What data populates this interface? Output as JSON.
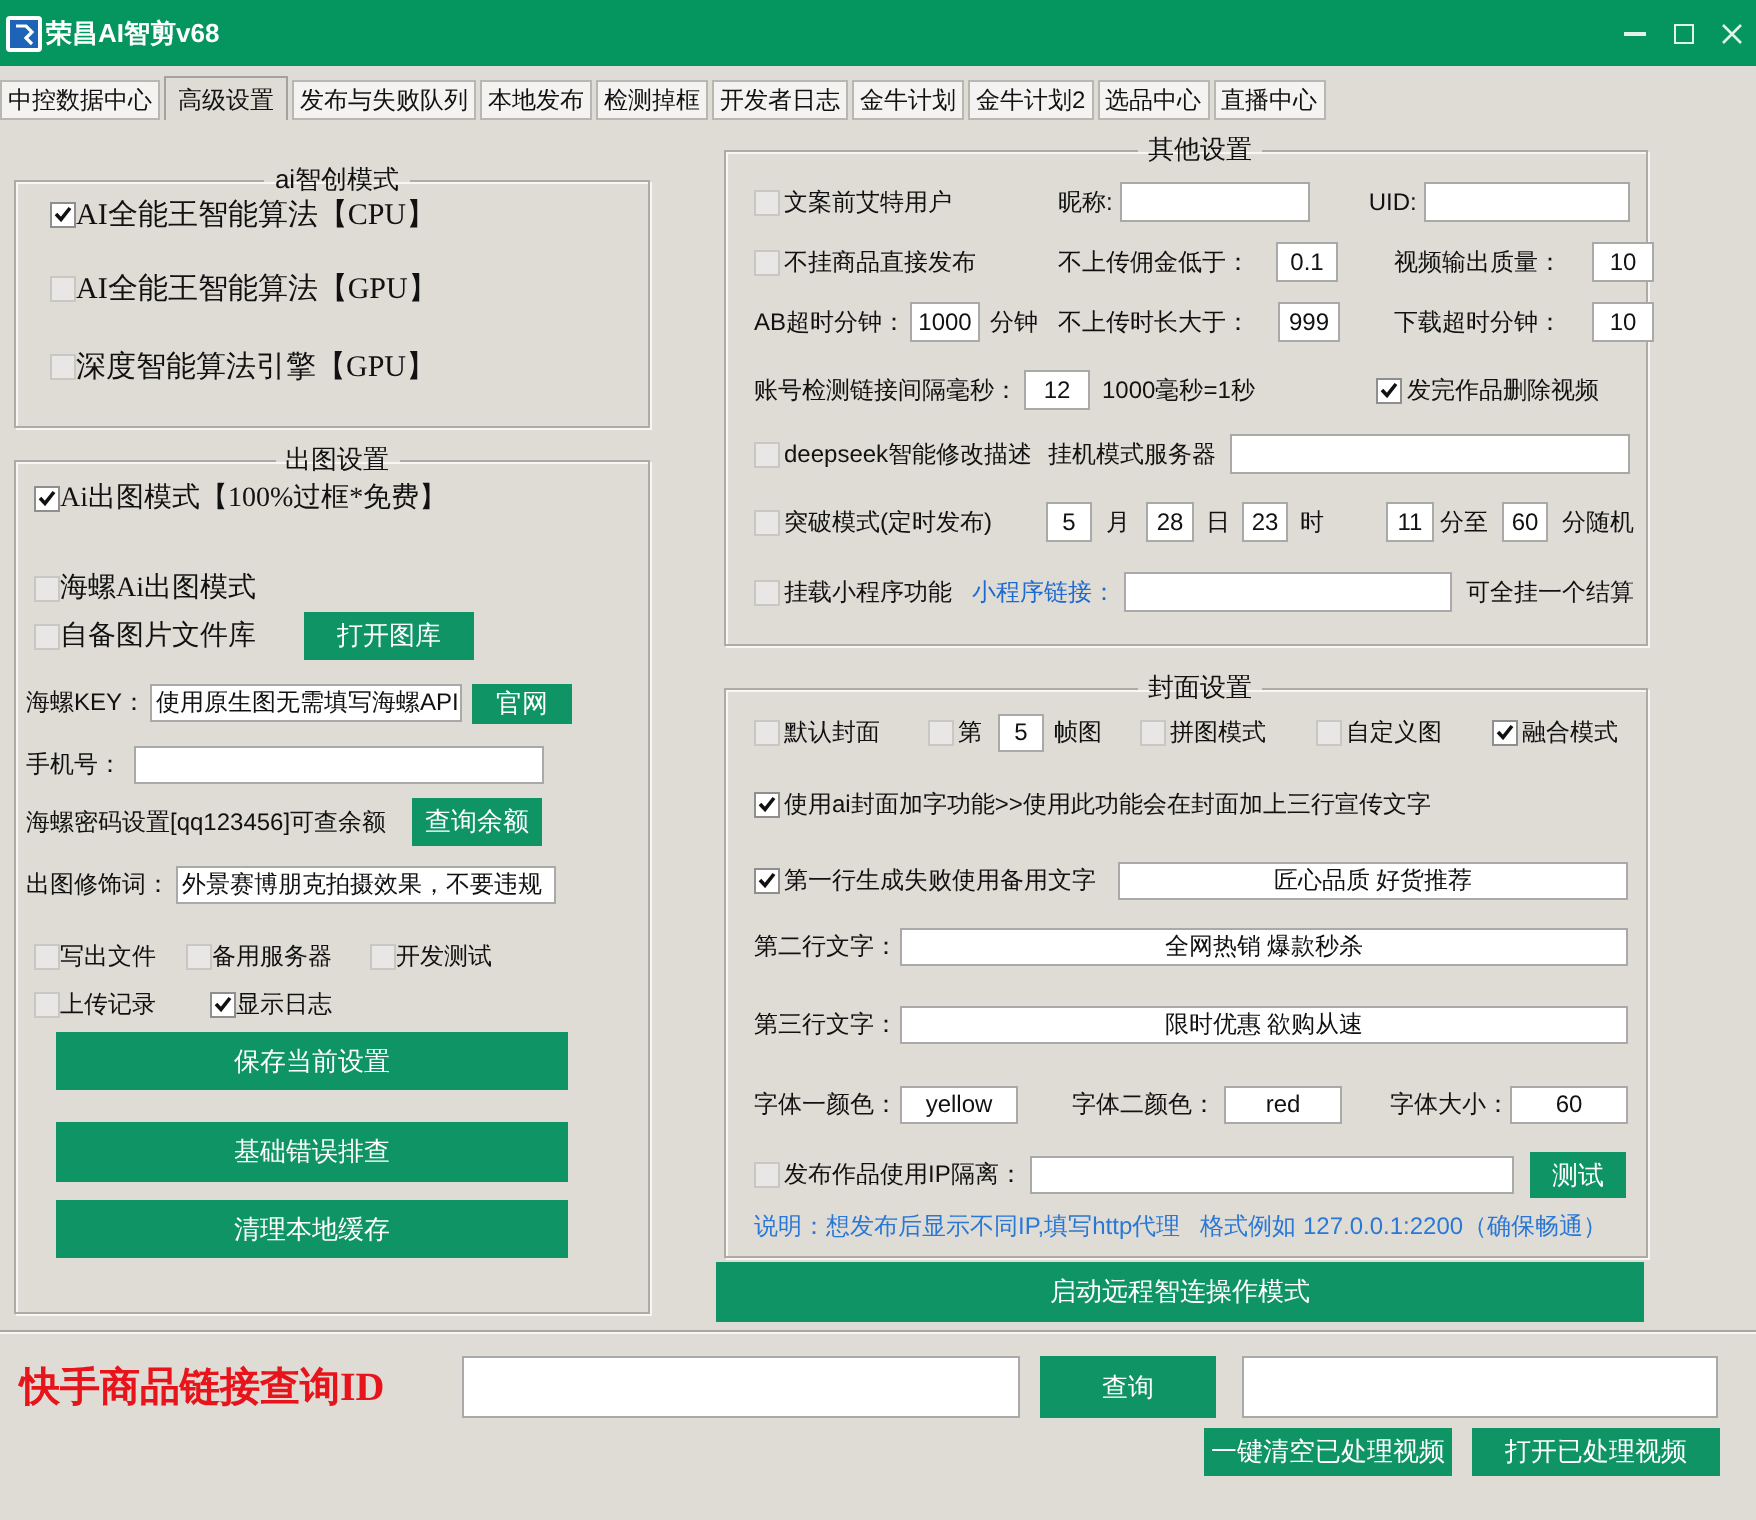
{
  "window": {
    "title": "荣昌AI智剪v68"
  },
  "tabs": [
    {
      "label": "中控数据中心",
      "selected": false
    },
    {
      "label": "高级设置",
      "selected": true
    },
    {
      "label": "发布与失败队列",
      "selected": false
    },
    {
      "label": "本地发布",
      "selected": false
    },
    {
      "label": "检测掉框",
      "selected": false
    },
    {
      "label": "开发者日志",
      "selected": false
    },
    {
      "label": "金牛计划",
      "selected": false
    },
    {
      "label": "金牛计划2",
      "selected": false
    },
    {
      "label": "选品中心",
      "selected": false
    },
    {
      "label": "直播中心",
      "selected": false
    }
  ],
  "ai_mode": {
    "title": "ai智创模式",
    "rows": [
      {
        "items": [
          {
            "kind": "checkbox",
            "label": "AI全能王智能算法【CPU】",
            "checked": true
          }
        ]
      },
      {
        "items": [
          {
            "kind": "checkbox",
            "label": "AI全能王智能算法【GPU】",
            "checked": false
          }
        ]
      },
      {
        "items": [
          {
            "kind": "checkbox",
            "label": "深度智能算法引擎【GPU】",
            "checked": false
          }
        ]
      }
    ]
  },
  "image_settings": {
    "title": "出图设置",
    "rows": [
      {
        "items": [
          {
            "kind": "checkbox",
            "label": "Ai出图模式【100%过框*免费】",
            "checked": true
          }
        ]
      },
      {
        "items": [
          {
            "kind": "checkbox",
            "label": "海螺Ai出图模式",
            "checked": false
          }
        ]
      },
      {
        "items": [
          {
            "kind": "checkbox",
            "label": "自备图片文件库",
            "checked": false
          },
          {
            "kind": "button",
            "label": "打开图库"
          }
        ]
      },
      {
        "items": [
          {
            "kind": "label",
            "text": "海螺KEY："
          },
          {
            "kind": "field",
            "value": "使用原生图无需填写海螺API"
          },
          {
            "kind": "button",
            "label": "官网"
          }
        ]
      },
      {
        "items": [
          {
            "kind": "label",
            "text": "手机号："
          },
          {
            "kind": "field"
          }
        ]
      },
      {
        "items": [
          {
            "kind": "label",
            "text": "海螺密码设置[qq123456]可查余额"
          },
          {
            "kind": "button",
            "label": "查询余额"
          }
        ]
      },
      {
        "items": [
          {
            "kind": "label",
            "text": "出图修饰词："
          },
          {
            "kind": "field",
            "value": "外景赛博朋克拍摄效果，不要违规"
          }
        ]
      },
      {
        "items": [
          {
            "kind": "checkbox",
            "label": "写出文件",
            "checked": false
          },
          {
            "kind": "checkbox",
            "label": "备用服务器",
            "checked": false
          },
          {
            "kind": "checkbox",
            "label": "开发测试",
            "checked": false
          }
        ]
      },
      {
        "items": [
          {
            "kind": "checkbox",
            "label": "上传记录",
            "checked": false
          },
          {
            "kind": "checkbox",
            "label": "显示日志",
            "checked": true
          }
        ]
      }
    ],
    "buttons": [
      "保存当前设置",
      "基础错误排查",
      "清理本地缓存"
    ]
  },
  "other_settings": {
    "title": "其他设置",
    "rows": [
      {
        "items": [
          {
            "kind": "checkbox",
            "label": "文案前艾特用户",
            "checked": false
          },
          {
            "kind": "label",
            "text": "昵称:"
          },
          {
            "kind": "field"
          },
          {
            "kind": "label",
            "text": "UID:"
          },
          {
            "kind": "field"
          }
        ]
      },
      {
        "items": [
          {
            "kind": "checkbox",
            "label": "不挂商品直接发布",
            "checked": false
          },
          {
            "kind": "label",
            "text": "不上传佣金低于："
          },
          {
            "kind": "field",
            "value": "0.1"
          },
          {
            "kind": "label",
            "text": "视频输出质量："
          },
          {
            "kind": "field",
            "value": "10"
          }
        ]
      },
      {
        "items": [
          {
            "kind": "label",
            "text": "AB超时分钟："
          },
          {
            "kind": "field",
            "value": "1000"
          },
          {
            "kind": "label",
            "text": "分钟"
          },
          {
            "kind": "label",
            "text": "不上传时长大于："
          },
          {
            "kind": "field",
            "value": "999"
          },
          {
            "kind": "label",
            "text": "下载超时分钟："
          },
          {
            "kind": "field",
            "value": "10"
          }
        ]
      },
      {
        "items": [
          {
            "kind": "label",
            "text": "账号检测链接间隔毫秒："
          },
          {
            "kind": "field",
            "value": "12"
          },
          {
            "kind": "label",
            "text": "1000毫秒=1秒"
          },
          {
            "kind": "checkbox",
            "label": "发完作品删除视频",
            "checked": true
          }
        ]
      },
      {
        "items": [
          {
            "kind": "checkbox",
            "label": "deepseek智能修改描述",
            "checked": false
          },
          {
            "kind": "label",
            "text": "挂机模式服务器"
          },
          {
            "kind": "field"
          }
        ]
      },
      {
        "items": [
          {
            "kind": "checkbox",
            "label": "突破模式(定时发布)",
            "checked": false
          },
          {
            "kind": "field",
            "value": "5"
          },
          {
            "kind": "label",
            "text": "月"
          },
          {
            "kind": "field",
            "value": "28"
          },
          {
            "kind": "label",
            "text": "日"
          },
          {
            "kind": "field",
            "value": "23"
          },
          {
            "kind": "label",
            "text": "时"
          },
          {
            "kind": "field",
            "value": "11"
          },
          {
            "kind": "label",
            "text": "分至"
          },
          {
            "kind": "field",
            "value": "60"
          },
          {
            "kind": "label",
            "text": "分随机"
          }
        ]
      },
      {
        "items": [
          {
            "kind": "checkbox",
            "label": "挂载小程序功能",
            "checked": false
          },
          {
            "kind": "link",
            "text": "小程序链接："
          },
          {
            "kind": "field"
          },
          {
            "kind": "label",
            "text": "可全挂一个结算"
          }
        ]
      }
    ]
  },
  "cover_settings": {
    "title": "封面设置",
    "rows": [
      {
        "items": [
          {
            "kind": "checkbox",
            "label": "默认封面",
            "checked": false
          },
          {
            "kind": "checkbox",
            "label": "第",
            "checked": false
          },
          {
            "kind": "field",
            "value": "5"
          },
          {
            "kind": "label",
            "text": "帧图"
          },
          {
            "kind": "checkbox",
            "label": "拼图模式",
            "checked": false
          },
          {
            "kind": "checkbox",
            "label": "自定义图",
            "checked": false
          },
          {
            "kind": "checkbox",
            "label": "融合模式",
            "checked": true
          }
        ]
      },
      {
        "items": [
          {
            "kind": "checkbox",
            "label": "使用ai封面加字功能>>使用此功能会在封面加上三行宣传文字",
            "checked": true
          }
        ]
      },
      {
        "items": [
          {
            "kind": "checkbox",
            "label": "第一行生成失败使用备用文字",
            "checked": true
          },
          {
            "kind": "field",
            "value": "匠心品质 好货推荐"
          }
        ]
      },
      {
        "items": [
          {
            "kind": "label",
            "text": "第二行文字："
          },
          {
            "kind": "field",
            "value": "全网热销 爆款秒杀"
          }
        ]
      },
      {
        "items": [
          {
            "kind": "label",
            "text": "第三行文字："
          },
          {
            "kind": "field",
            "value": "限时优惠 欲购从速"
          }
        ]
      },
      {
        "items": [
          {
            "kind": "label",
            "text": "字体一颜色："
          },
          {
            "kind": "field",
            "value": "yellow"
          },
          {
            "kind": "label",
            "text": "字体二颜色："
          },
          {
            "kind": "field",
            "value": "red"
          },
          {
            "kind": "label",
            "text": "字体大小："
          },
          {
            "kind": "field",
            "value": "60"
          }
        ]
      },
      {
        "items": [
          {
            "kind": "checkbox",
            "label": "发布作品使用IP隔离：",
            "checked": false
          },
          {
            "kind": "field"
          },
          {
            "kind": "button",
            "label": "测试"
          }
        ]
      },
      {
        "items": [
          {
            "kind": "note",
            "text": "说明：想发布后显示不同IP,填写http代理   格式例如 127.0.0.1:2200（确保畅通）"
          }
        ]
      }
    ]
  },
  "remote_button": "启动远程智连操作模式",
  "product_query": {
    "title": "快手商品链接查询ID",
    "query_button": "查询"
  },
  "bottom_buttons": [
    "一键清空已处理视频",
    "打开已处理视频"
  ]
}
